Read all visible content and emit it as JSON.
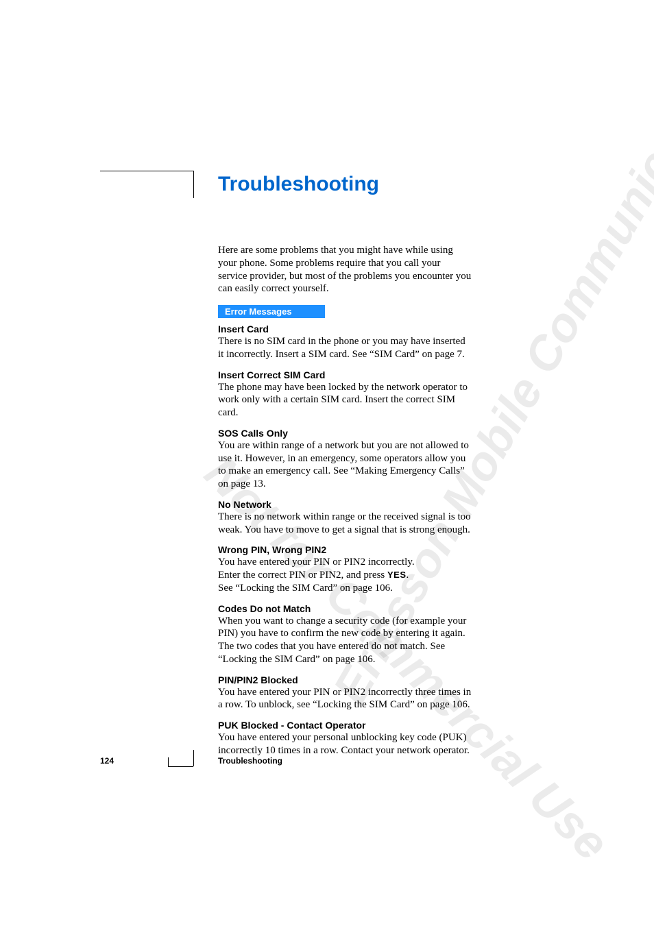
{
  "title": "Troubleshooting",
  "intro": "Here are some problems that you might have while using your phone. Some problems require that you call your service provider, but most of the problems you encounter you can easily correct yourself.",
  "section_bar": "Error Messages",
  "sections": [
    {
      "heading": "Insert Card",
      "body": "There is no SIM card in the phone or you may have inserted it incorrectly. Insert a SIM card. See “SIM Card” on page 7."
    },
    {
      "heading": "Insert Correct SIM Card",
      "body": "The phone may have been locked by the network operator to work only with a certain SIM card. Insert the correct SIM card."
    },
    {
      "heading": "SOS Calls Only",
      "body": "You are within range of a network but you are not allowed to use it. However, in an emergency, some operators allow you to make an emergency call. See “Making Emergency Calls” on page 13."
    },
    {
      "heading": "No Network",
      "body": "There is no network within range or the received signal is too weak. You have to move to get a signal that is strong enough."
    },
    {
      "heading": "Wrong PIN, Wrong PIN2",
      "body_pre": "You have entered your PIN or PIN2 incorrectly.\nEnter the correct PIN or PIN2, and press ",
      "yes_key": "YES",
      "body_post": ".\nSee “Locking the SIM Card” on page 106."
    },
    {
      "heading": "Codes Do not Match",
      "body": "When you want to change a security code (for example your PIN) you have to confirm the new code by entering it again. The two codes that you have entered do not match. See “Locking the SIM Card” on page 106."
    },
    {
      "heading": "PIN/PIN2 Blocked",
      "body": "You have entered your PIN or PIN2 incorrectly three times in a row. To unblock, see “Locking the SIM Card” on page 106."
    },
    {
      "heading": "PUK Blocked - Contact Operator",
      "body": "You have entered your personal unblocking key code (PUK) incorrectly 10 times in a row. Contact your network operator."
    }
  ],
  "footer": {
    "page_number": "124",
    "title": "Troubleshooting"
  },
  "watermarks": {
    "wm1": "Not for Commercial Use",
    "wm2": "Ericsson Mobile Communications AB"
  }
}
